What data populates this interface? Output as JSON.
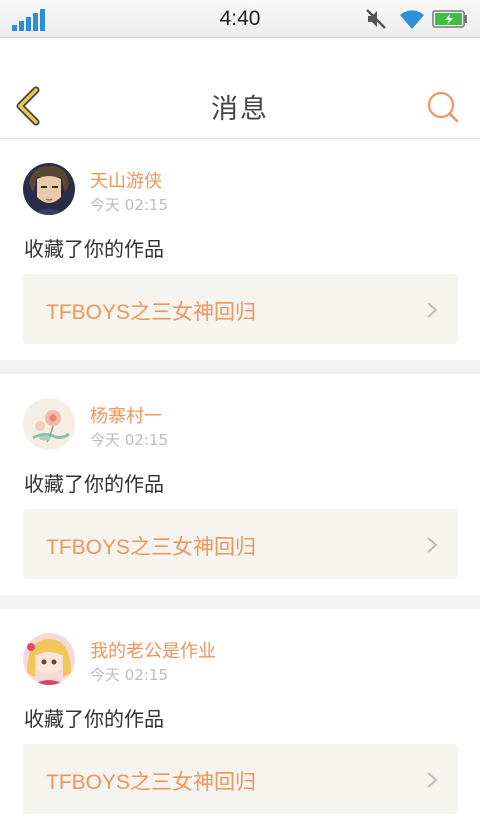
{
  "status_bar": {
    "time": "4:40",
    "icons": [
      "signal-icon",
      "mute-icon",
      "wifi-icon",
      "battery-charging-icon"
    ]
  },
  "header": {
    "title": "消息",
    "back_icon": "chevron-left-icon",
    "search_icon": "search-icon"
  },
  "colors": {
    "accent": "#f0945c",
    "back_icon": "#e8c84a",
    "card_bg": "#f5f4ee",
    "signal": "#2f8fd6",
    "battery": "#3fbf3f"
  },
  "messages": [
    {
      "username": "天山游侠",
      "time": "今天 02:15",
      "action": "收藏了你的作品",
      "work_title": "TFBOYS之三女神回归",
      "avatar": "anime-boy-avatar"
    },
    {
      "username": "杨寨村一",
      "time": "今天 02:15",
      "action": "收藏了你的作品",
      "work_title": "TFBOYS之三女神回归",
      "avatar": "flower-painting-avatar"
    },
    {
      "username": "我的老公是作业",
      "time": "今天 02:15",
      "action": "收藏了你的作品",
      "work_title": "TFBOYS之三女神回归",
      "avatar": "anime-girl-avatar"
    }
  ]
}
